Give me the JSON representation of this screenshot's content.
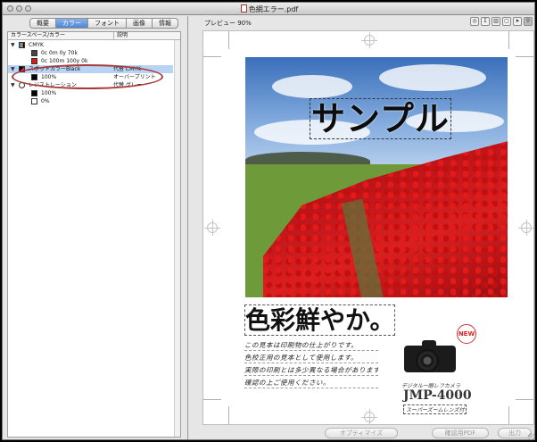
{
  "window": {
    "title": "色網エラー.pdf"
  },
  "left_pane": {
    "tabs": [
      {
        "label": "概要",
        "active": false
      },
      {
        "label": "カラー",
        "active": true
      },
      {
        "label": "フォント",
        "active": false
      },
      {
        "label": "画像",
        "active": false
      },
      {
        "label": "情報",
        "active": false
      }
    ],
    "list_header": {
      "col1": "カラースペース/カラー",
      "col2": "説明"
    },
    "rows": [
      {
        "label": "CMYK",
        "description": "",
        "level": 0,
        "icon": "cmyk-icon",
        "selected": false
      },
      {
        "label": "0c 0m 0y 70k",
        "description": "",
        "level": 1,
        "swatch": "#444444",
        "selected": false
      },
      {
        "label": "0c 100m 100y 0k",
        "description": "",
        "level": 1,
        "swatch": "#e01818",
        "selected": false
      },
      {
        "label": "スポットカラーBlack",
        "description": "代替 CMYK",
        "level": 0,
        "icon": "spot-color-icon",
        "selected": true
      },
      {
        "label": "100%",
        "description": "オーバープリント",
        "level": 1,
        "swatch": "#000000",
        "selected": false
      },
      {
        "label": "レジストレーション",
        "description": "代替 グレー",
        "level": 0,
        "icon": "registration-icon",
        "selected": false
      },
      {
        "label": "100%",
        "description": "",
        "level": 1,
        "swatch": "#000000",
        "selected": false
      },
      {
        "label": "0%",
        "description": "",
        "level": 1,
        "swatch": "#ffffff",
        "selected": false
      }
    ]
  },
  "right_pane": {
    "preview_label": "プレビュー 90%",
    "toolbar_icons": [
      "overprint-icon",
      "sigma-icon",
      "separations-icon",
      "page-icon",
      "arrow-icon",
      "zoom-icon"
    ],
    "document": {
      "headline": "サンプル",
      "subheadline": "色彩鮮やか。",
      "body_lines": [
        "この見本は印刷物の仕上がりです。",
        "色校正用の見本として使用します。",
        "実際の印刷とは多少異なる場合があります。",
        "確認の上ご使用ください。"
      ],
      "badge": "NEW",
      "product_caption": "デジタル一眼レフカメラ",
      "product_model": "JMP-4000",
      "product_sub": "スーパーズームレンズ付"
    },
    "buttons": {
      "optimize": "オプティマイズ",
      "proof_pdf": "確認用PDF",
      "output": "出力"
    }
  }
}
